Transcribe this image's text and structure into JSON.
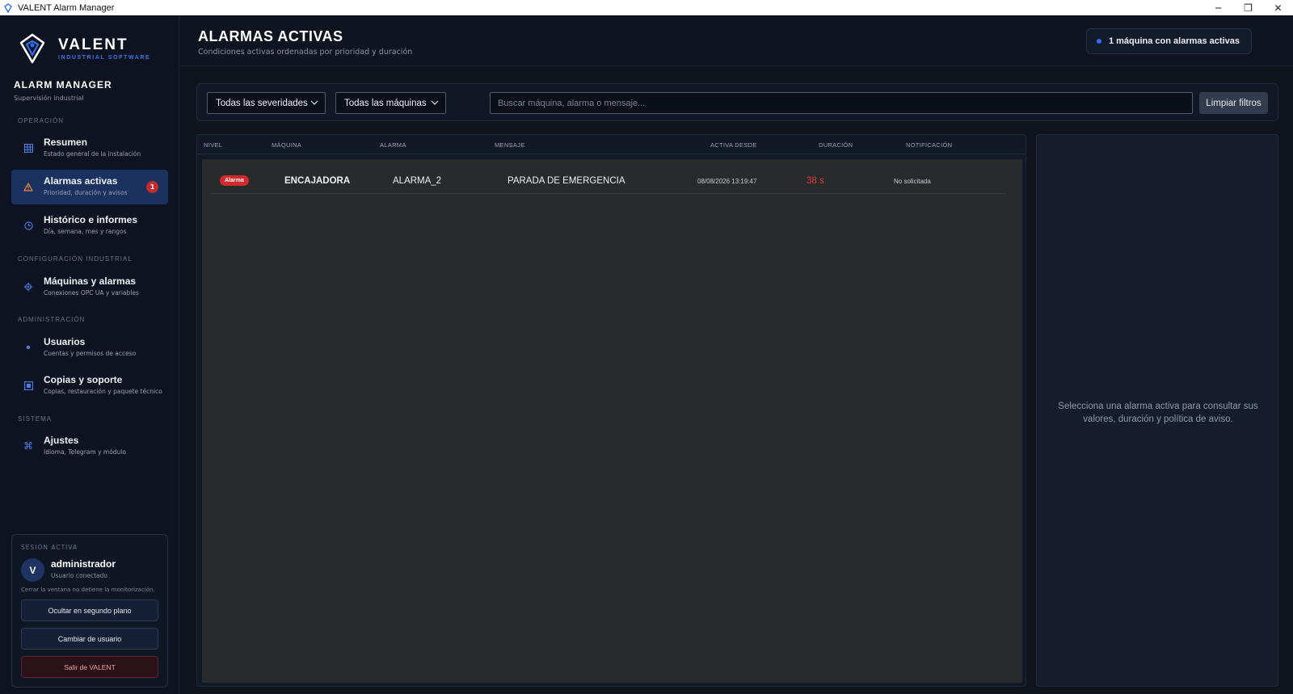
{
  "window": {
    "title": "VALENT Alarm Manager",
    "minimize": "─",
    "maximize": "❐",
    "close": "✕"
  },
  "brand": {
    "name": "VALENT",
    "tagline": "INDUSTRIAL SOFTWARE",
    "app_name": "ALARM MANAGER",
    "app_sub": "Supervisión industrial",
    "accent": "#2f6ef0"
  },
  "sidebar": {
    "sections": {
      "operation": "OPERACIÓN",
      "industrial": "CONFIGURACIÓN INDUSTRIAL",
      "admin": "ADMINISTRACIÓN",
      "system": "SISTEMA"
    },
    "items": [
      {
        "title": "Resumen",
        "desc": "Estado general de la instalación",
        "icon": "grid-icon"
      },
      {
        "title": "Alarmas activas",
        "desc": "Prioridad, duración y avisos",
        "icon": "warning-icon",
        "badge": "1",
        "active": true
      },
      {
        "title": "Histórico e informes",
        "desc": "Día, semana, mes y rangos",
        "icon": "clock-icon"
      },
      {
        "title": "Máquinas y alarmas",
        "desc": "Conexiones OPC UA y variables",
        "icon": "gear-icon"
      },
      {
        "title": "Usuarios",
        "desc": "Cuentas y permisos de acceso",
        "icon": "user-dot-icon"
      },
      {
        "title": "Copias y soporte",
        "desc": "Copias, restauración y paquete técnico",
        "icon": "backup-icon"
      },
      {
        "title": "Ajustes",
        "desc": "Idioma, Telegram y módulo",
        "icon": "command-icon"
      }
    ]
  },
  "session": {
    "label": "SESIÓN ACTIVA",
    "avatar_letter": "V",
    "user": "administrador",
    "status": "Usuario conectado",
    "note": "Cerrar la ventana no detiene la monitorización.",
    "hide_label": "Ocultar en segundo plano",
    "switch_label": "Cambiar de usuario",
    "exit_label": "Salir de VALENT"
  },
  "header": {
    "title": "ALARMAS ACTIVAS",
    "subtitle": "Condiciones activas ordenadas por prioridad y duración",
    "status": "1 máquina con alarmas activas"
  },
  "filters": {
    "severity": "Todas las severidades",
    "machine": "Todas las máquinas",
    "search_placeholder": "Buscar máquina, alarma o mensaje...",
    "clear_label": "Limpiar filtros"
  },
  "table": {
    "columns": [
      "NIVEL",
      "MÁQUINA",
      "ALARMA",
      "MENSAJE",
      "ACTIVA DESDE",
      "DURACIÓN",
      "NOTIFICACIÓN"
    ],
    "rows": [
      {
        "level": "Alarma",
        "machine": "ENCAJADORA",
        "alarm": "ALARMA_2",
        "message": "PARADA DE EMERGENCIA",
        "since": "08/08/2026 13:19:47",
        "duration": "38 s",
        "notification": "No solicitada"
      }
    ],
    "severity_color": "#d02a2a",
    "duration_color": "#e03a3a"
  },
  "detail": {
    "empty_message": "Selecciona una alarma activa para consultar sus valores, duración y política de aviso."
  }
}
